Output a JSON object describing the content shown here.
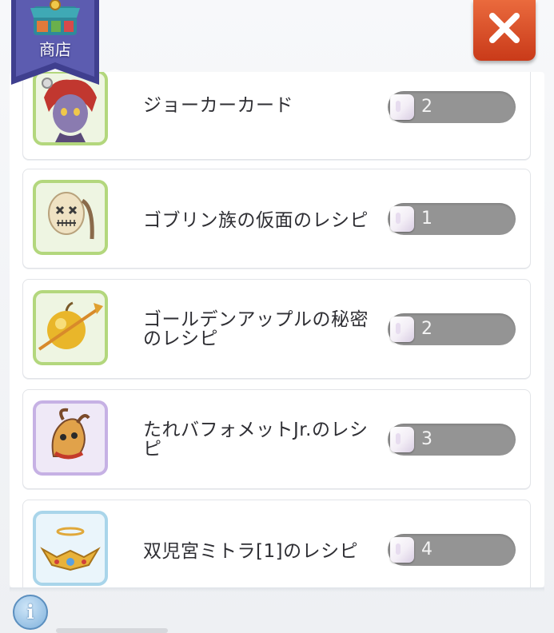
{
  "header": {
    "banner_label": "商店",
    "banner_icon": "shop-stall-icon",
    "close_icon": "close-x-icon"
  },
  "items": [
    {
      "name": "ジョーカーカード",
      "cost": "2",
      "icon": "joker-card-portrait",
      "frame_color": "#b3d77d"
    },
    {
      "name": "ゴブリン族の仮面のレシピ",
      "cost": "1",
      "icon": "goblin-mask-icon",
      "frame_color": "#b3d77d"
    },
    {
      "name": "ゴールデンアップルの秘密のレシピ",
      "cost": "2",
      "icon": "golden-apple-icon",
      "frame_color": "#b3d77d"
    },
    {
      "name": "たれバフォメットJr.のレシピ",
      "cost": "3",
      "icon": "baphomet-jr-hat-icon",
      "frame_color": "#c6b1e4"
    },
    {
      "name": "双児宮ミトラ[1]のレシピ",
      "cost": "4",
      "icon": "gemini-mitra-crown-icon",
      "frame_color": "#a9d5ea"
    }
  ],
  "currency_icon": "crystal-gem-icon",
  "footer": {
    "info_glyph": "i",
    "info_icon": "info-icon"
  }
}
